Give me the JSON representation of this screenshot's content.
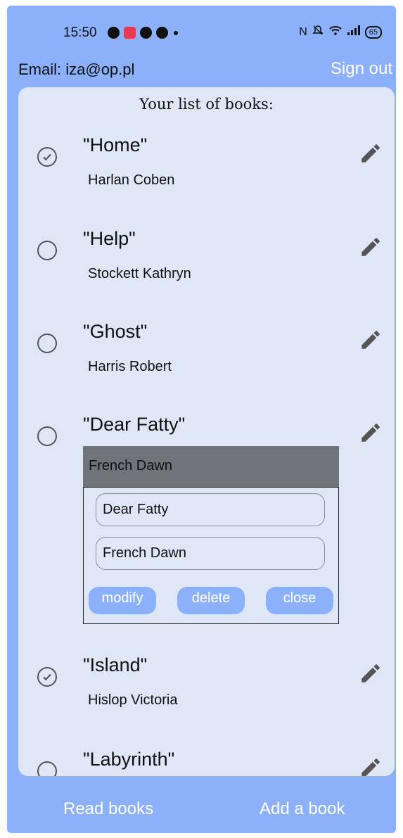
{
  "status_bar": {
    "time": "15:50",
    "battery": "65",
    "icons_left": [
      "face-icon",
      "record-icon",
      "pinterest-icon",
      "arrow-icon"
    ],
    "icons_right": [
      "nfc-icon",
      "mute-icon",
      "wifi-icon",
      "signal-icon",
      "battery-icon"
    ]
  },
  "header": {
    "email": "Email: iza@op.pl",
    "sign_out": "Sign out"
  },
  "list": {
    "title": "Your list of books:",
    "books": [
      {
        "title": "\"Home\"",
        "author": "Harlan Coben",
        "read": true
      },
      {
        "title": "\"Help\"",
        "author": "Stockett Kathryn",
        "read": false
      },
      {
        "title": "\"Ghost\"",
        "author": "Harris Robert",
        "read": false
      },
      {
        "title": "\"Dear Fatty\"",
        "author": "French Dawn",
        "read": false
      },
      {
        "title": "\"Island\"",
        "author": "Hislop Victoria",
        "read": true
      },
      {
        "title": "\"Labyrinth\"",
        "author": "",
        "read": false
      }
    ]
  },
  "edit_panel": {
    "title_value": "Dear Fatty",
    "author_value": "French Dawn",
    "modify_label": "modify",
    "delete_label": "delete",
    "close_label": "close"
  },
  "bottom_nav": {
    "read_books": "Read books",
    "add_book": "Add a book"
  },
  "colors": {
    "background": "#8cb1fa",
    "card": "#dfe6f6",
    "author_bar": "#6f747b",
    "button": "#8cb1fa"
  }
}
